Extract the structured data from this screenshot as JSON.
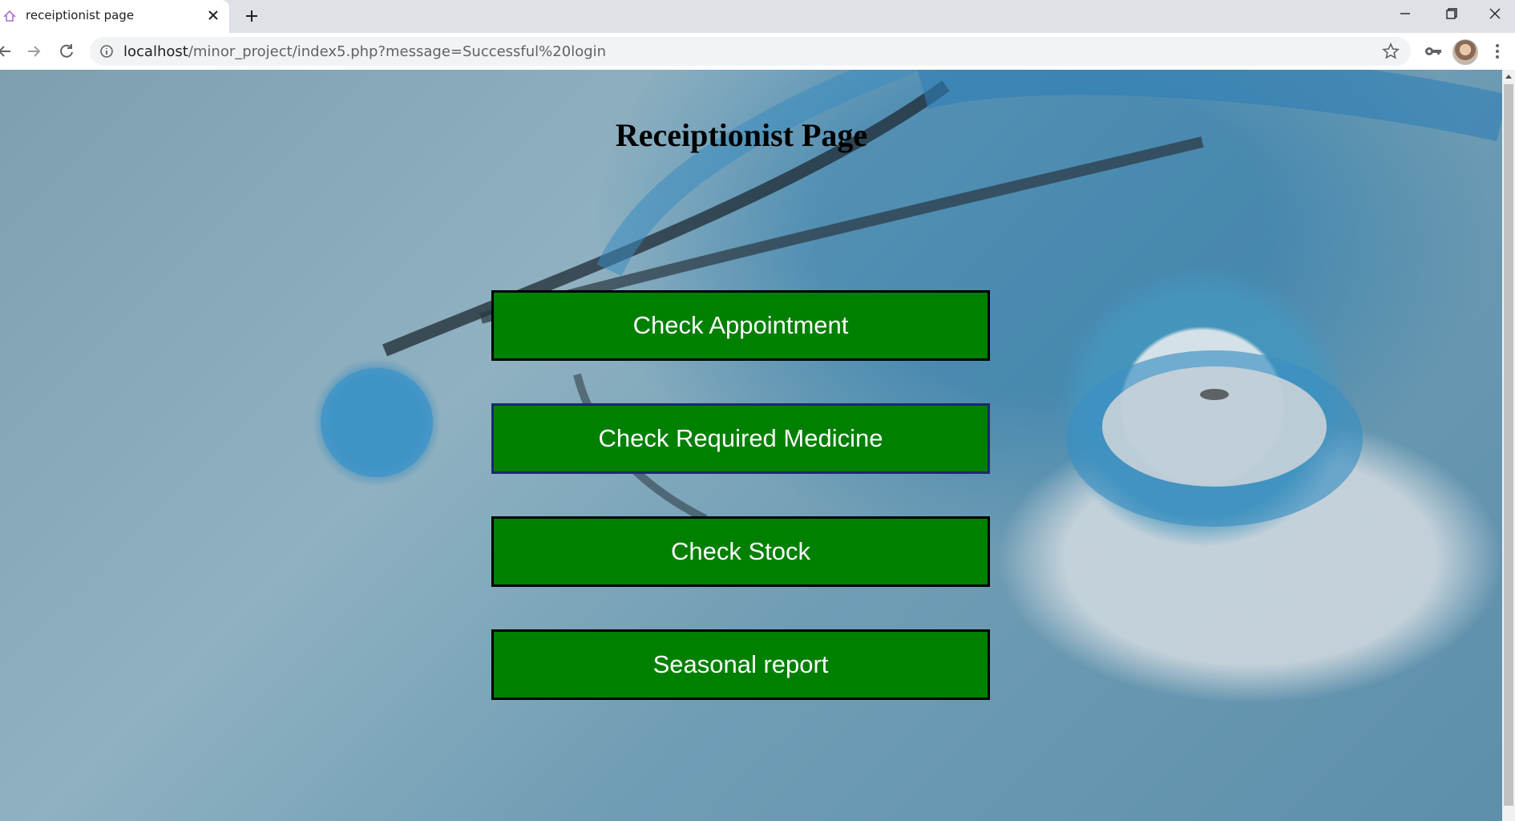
{
  "browser": {
    "tab": {
      "title": "receiptionist page"
    },
    "address_bar": {
      "host": "localhost",
      "path": "/minor_project/index5.php?message=Successful%20login"
    }
  },
  "page": {
    "heading": "Receiptionist Page",
    "buttons": [
      {
        "label": "Check Appointment"
      },
      {
        "label": "Check Required Medicine"
      },
      {
        "label": "Check Stock"
      },
      {
        "label": "Seasonal report"
      }
    ]
  },
  "colors": {
    "button_bg": "#008000",
    "button_text": "#ffffff",
    "button_border": "#000000"
  }
}
